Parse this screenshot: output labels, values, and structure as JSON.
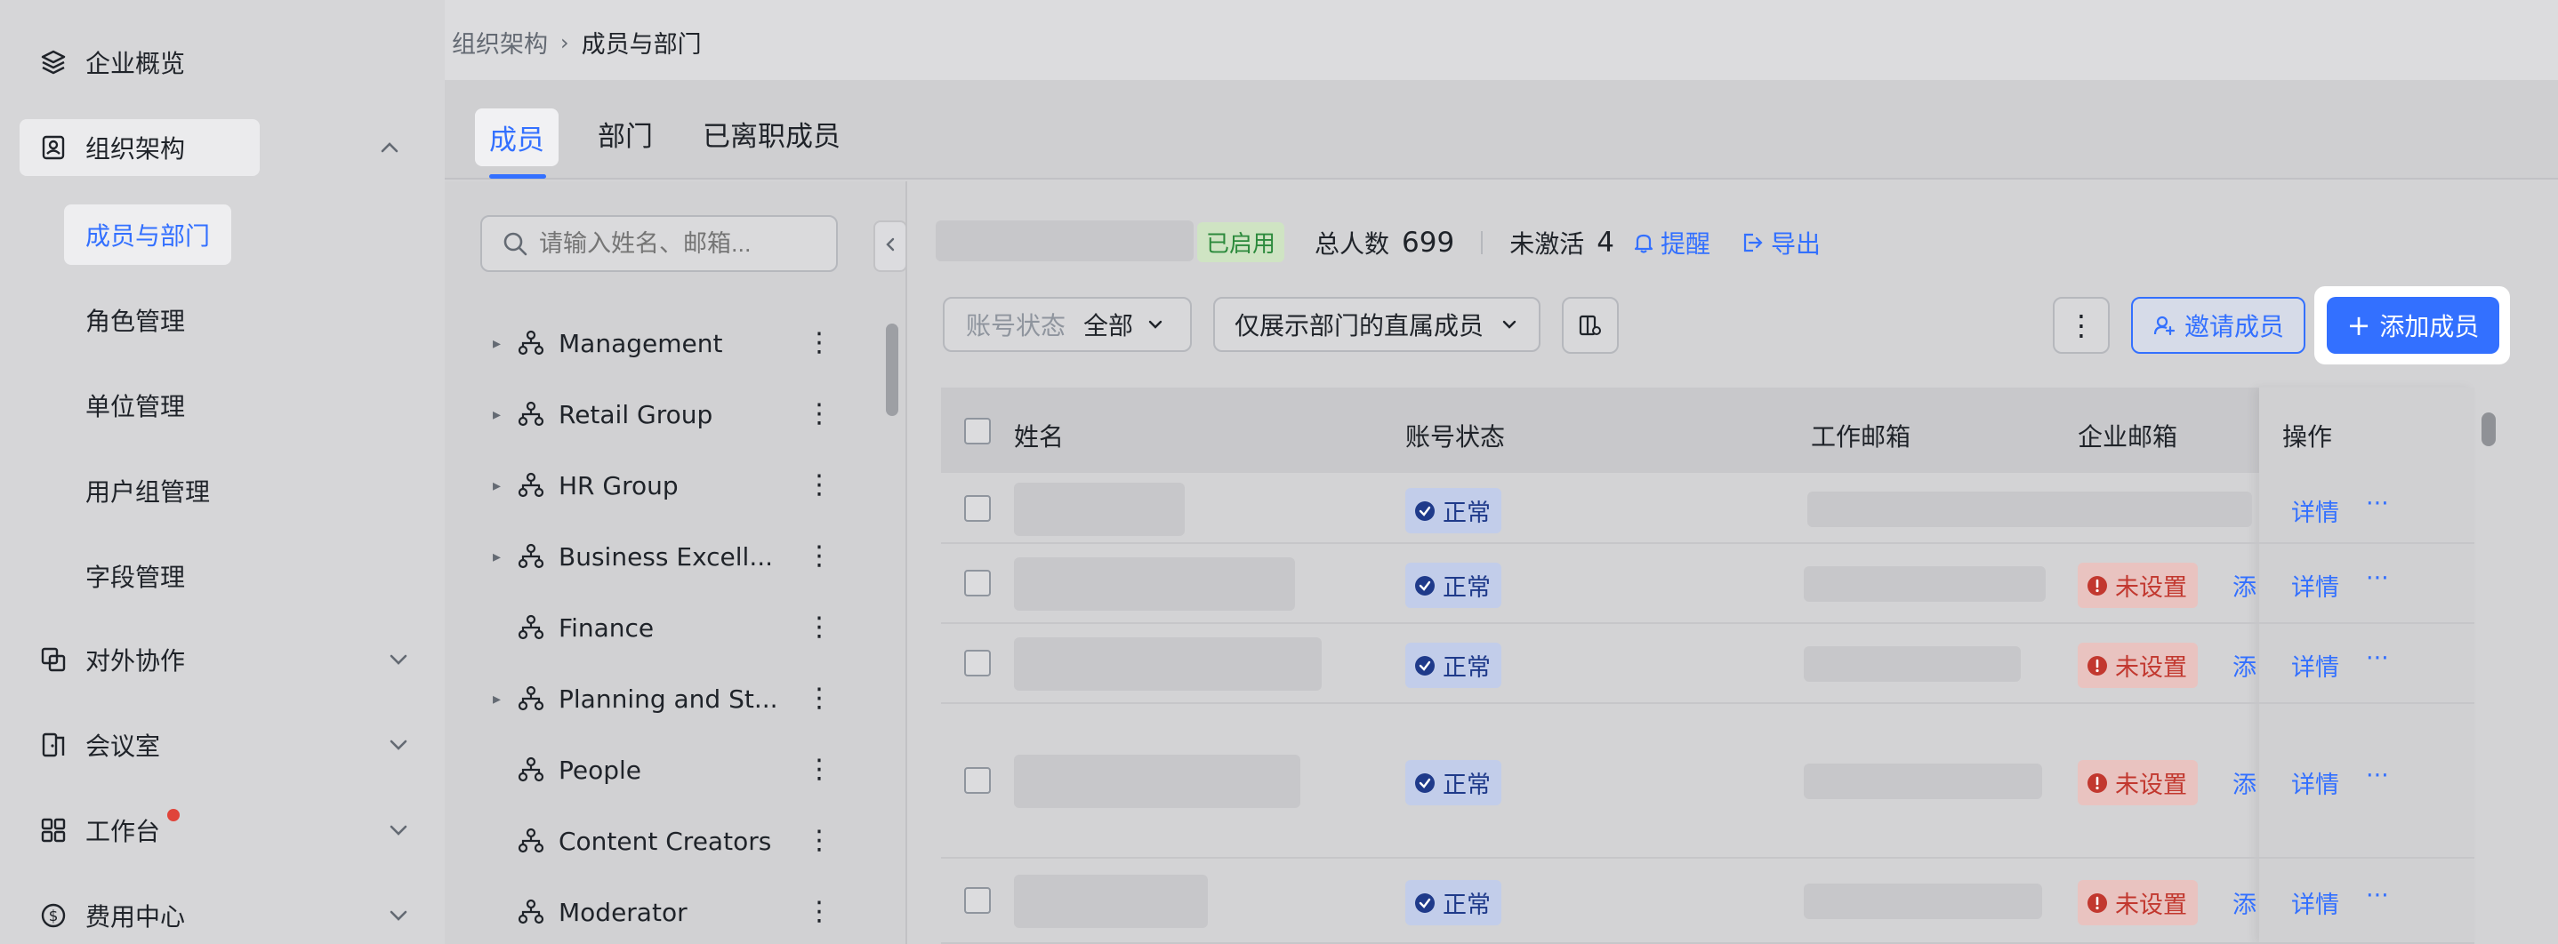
{
  "sidebar": {
    "items": [
      {
        "label": "企业概览",
        "icon": "layers-icon"
      },
      {
        "label": "组织架构",
        "icon": "contact-book-icon"
      },
      {
        "label": "对外协作",
        "icon": "external-collab-icon"
      },
      {
        "label": "会议室",
        "icon": "meeting-room-icon"
      },
      {
        "label": "工作台",
        "icon": "workbench-grid-icon"
      },
      {
        "label": "费用中心",
        "icon": "dollar-icon"
      }
    ],
    "sub_items": [
      "成员与部门",
      "角色管理",
      "单位管理",
      "用户组管理",
      "字段管理"
    ]
  },
  "breadcrumb": {
    "parent": "组织架构",
    "current": "成员与部门"
  },
  "tabs": [
    "成员",
    "部门",
    "已离职成员"
  ],
  "search": {
    "placeholder": "请输入姓名、邮箱..."
  },
  "tree": [
    {
      "label": "Management",
      "expandable": true
    },
    {
      "label": "Retail Group",
      "expandable": true
    },
    {
      "label": "HR Group",
      "expandable": true
    },
    {
      "label": "Business Excell...",
      "expandable": true
    },
    {
      "label": "Finance",
      "expandable": false
    },
    {
      "label": "Planning and St...",
      "expandable": true
    },
    {
      "label": "People",
      "expandable": false
    },
    {
      "label": "Content Creators",
      "expandable": false
    },
    {
      "label": "Moderator",
      "expandable": false
    }
  ],
  "summary": {
    "enabled_badge": "已启用",
    "total_label": "总人数",
    "total_value": "699",
    "inactive_label": "未激活",
    "inactive_value": "4",
    "remind_label": "提醒",
    "export_label": "导出"
  },
  "filters": {
    "account_status_label": "账号状态",
    "account_status_value": "全部",
    "scope_value": "仅展示部门的直属成员"
  },
  "actions": {
    "invite_label": "邀请成员",
    "add_label": "添加成员"
  },
  "table": {
    "headers": [
      "姓名",
      "账号状态",
      "工作邮箱",
      "企业邮箱",
      "操作"
    ],
    "rows": [
      {
        "status": "正常",
        "enterprise_email": "",
        "add": "",
        "detail": "详情",
        "more": "···"
      },
      {
        "status": "正常",
        "enterprise_email": "未设置",
        "add": "添",
        "detail": "详情",
        "more": "···"
      },
      {
        "status": "正常",
        "enterprise_email": "未设置",
        "add": "添",
        "detail": "详情",
        "more": "···"
      },
      {
        "status": "正常",
        "enterprise_email": "未设置",
        "add": "添",
        "detail": "详情",
        "more": "···"
      },
      {
        "status": "正常",
        "enterprise_email": "未设置",
        "add": "添",
        "detail": "详情",
        "more": "···"
      }
    ]
  },
  "colors": {
    "accent": "#3370ff",
    "ok": "#1f3a8a",
    "warn": "#c2382f",
    "enabled": "#2c8a3c"
  }
}
